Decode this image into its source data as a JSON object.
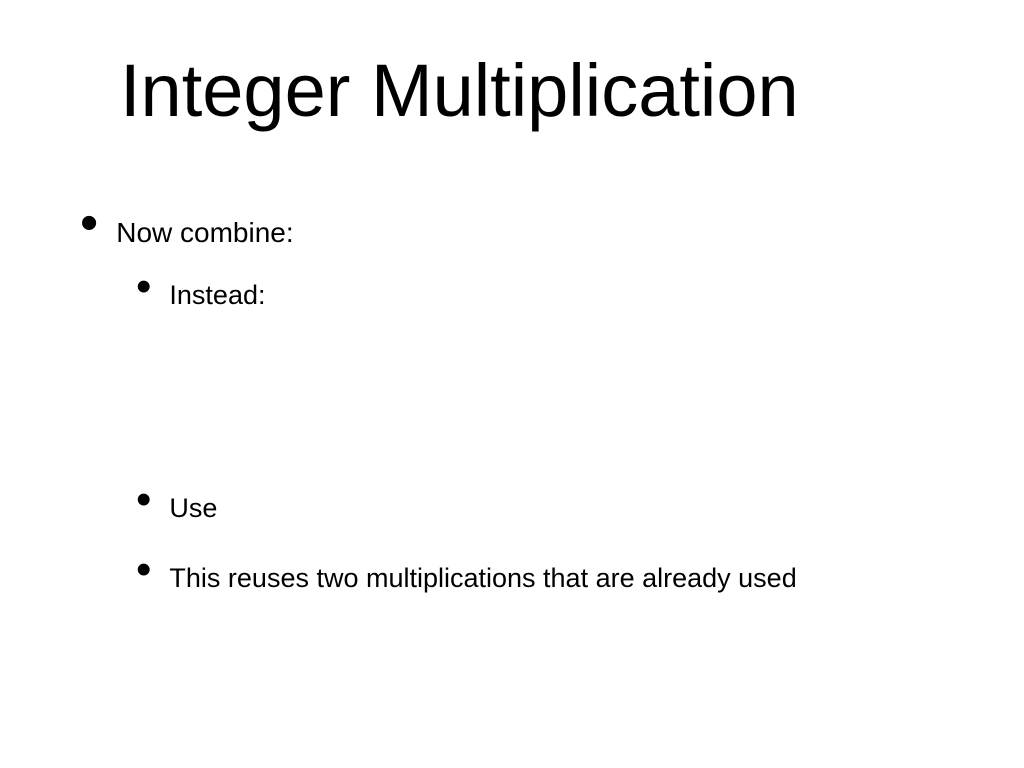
{
  "title": "Integer Multiplication",
  "bullets": {
    "level1": {
      "item1": "Now combine:"
    },
    "level2": {
      "item1": "Instead:",
      "item2": "Use",
      "item3": "This reuses two multiplications that are already used"
    }
  }
}
